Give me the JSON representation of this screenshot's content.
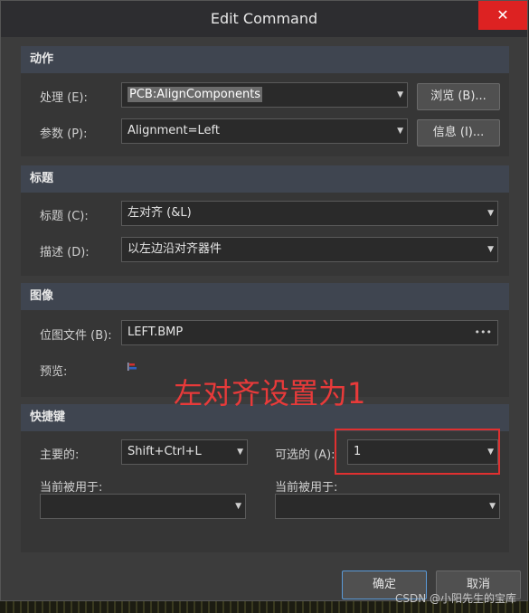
{
  "window": {
    "title": "Edit Command",
    "close_label": "✕"
  },
  "action": {
    "header": "动作",
    "process_label": "处理 (E):",
    "process_value": "PCB:AlignComponents",
    "params_label": "参数 (P):",
    "params_value": "Alignment=Left",
    "browse_label": "浏览 (B)...",
    "info_label": "信息 (I)..."
  },
  "caption": {
    "header": "标题",
    "title_label": "标题 (C):",
    "title_value": "左对齐 (&L)",
    "desc_label": "描述 (D):",
    "desc_value": "以左边沿对齐器件"
  },
  "image": {
    "header": "图像",
    "bitmap_label": "位图文件 (B):",
    "bitmap_value": "LEFT.BMP",
    "bitmap_more": "•••",
    "preview_label": "预览:"
  },
  "shortcut": {
    "header": "快捷键",
    "primary_label": "主要的:",
    "primary_value": "Shift+Ctrl+L",
    "alt_label": "可选的 (A):",
    "alt_value": "1",
    "used_by_label_1": "当前被用于:",
    "used_by_label_2": "当前被用于:"
  },
  "footer": {
    "ok_label": "确定",
    "cancel_label": "取消"
  },
  "annotation": {
    "text": "左对齐设置为1"
  },
  "watermark": {
    "text": "CSDN @小阳先生的宝库"
  }
}
